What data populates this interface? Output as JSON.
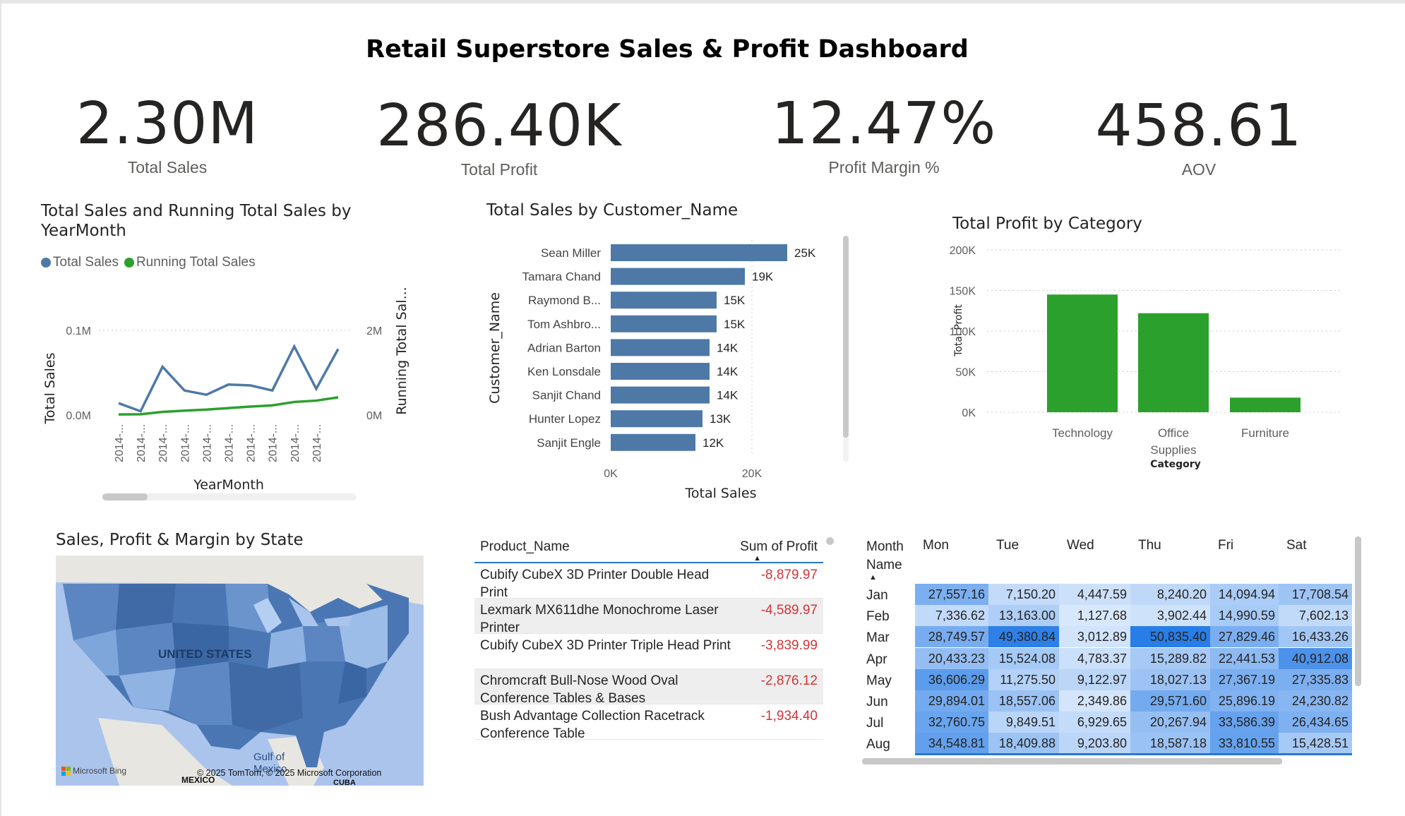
{
  "title": "Retail Superstore Sales & Profit Dashboard",
  "kpis": [
    {
      "value": "2.30M",
      "label": "Total Sales"
    },
    {
      "value": "286.40K",
      "label": "Total Profit"
    },
    {
      "value": "12.47%",
      "label": "Profit Margin %"
    },
    {
      "value": "458.61",
      "label": "AOV"
    }
  ],
  "colors": {
    "blue": "#4e79a7",
    "green": "#2ca02c",
    "neg": "#d13438",
    "accent": "#2a78c8"
  },
  "line_chart": {
    "title_line1": "Total Sales and Running Total Sales by",
    "title_line2": "YearMonth",
    "legend": [
      "Total Sales",
      "Running Total Sales"
    ],
    "y_left_title": "Total Sales",
    "y_right_title": "Running Total Sal...",
    "x_title": "YearMonth",
    "y_left_ticks": [
      "0.1M",
      "0.0M"
    ],
    "y_right_ticks": [
      "2M",
      "0M"
    ],
    "x_tick": "2014-..."
  },
  "bar_chart": {
    "title": "Total Sales by Customer_Name",
    "y_title": "Customer_Name",
    "x_title": "Total Sales",
    "x_ticks": [
      "0K",
      "20K"
    ]
  },
  "col_chart": {
    "title": "Total Profit by Category",
    "y_title": "Total Profit",
    "x_title": "Category",
    "y_ticks": [
      "200K",
      "150K",
      "100K",
      "50K",
      "0K"
    ]
  },
  "chart_data": [
    {
      "type": "line",
      "x": [
        "2014-...",
        "2014-...",
        "2014-...",
        "2014-...",
        "2014-...",
        "2014-...",
        "2014-...",
        "2014-...",
        "2014-...",
        "2014-..."
      ],
      "series": [
        {
          "name": "Total Sales",
          "axis": "left",
          "values": [
            14000,
            4500,
            57000,
            29000,
            24000,
            36000,
            35000,
            29000,
            81000,
            31000,
            78000
          ]
        },
        {
          "name": "Running Total Sales",
          "axis": "right",
          "values": [
            14000,
            18500,
            75500,
            104500,
            128500,
            164500,
            199500,
            228500,
            309500,
            340500,
            418500
          ]
        }
      ],
      "ylim_left": [
        0,
        100000
      ],
      "ylim_right": [
        0,
        2000000
      ],
      "grid": true
    },
    {
      "type": "bar",
      "orientation": "horizontal",
      "categories": [
        "Sean Miller",
        "Tamara Chand",
        "Raymond B...",
        "Tom Ashbro...",
        "Adrian Barton",
        "Ken Lonsdale",
        "Sanjit Chand",
        "Hunter Lopez",
        "Sanjit Engle"
      ],
      "values": [
        25000,
        19000,
        15000,
        15000,
        14000,
        14000,
        14000,
        13000,
        12000
      ],
      "labels": [
        "25K",
        "19K",
        "15K",
        "15K",
        "14K",
        "14K",
        "14K",
        "13K",
        "12K"
      ],
      "xlim": [
        0,
        25000
      ]
    },
    {
      "type": "bar",
      "categories": [
        "Technology",
        "Office Supplies",
        "Furniture"
      ],
      "values": [
        145000,
        122000,
        18000
      ],
      "ylim": [
        0,
        200000
      ],
      "grid": true
    }
  ],
  "map": {
    "title": "Sales, Profit & Margin by State",
    "country_label": "UNITED STATES",
    "gulf_label1": "Gulf of",
    "gulf_label2": "Mexico",
    "mexico_label": "MEXICO",
    "cuba_label": "CUBA",
    "brand": "Microsoft Bing",
    "copyright": "© 2025 TomTom, © 2025 Microsoft Corporation"
  },
  "product_table": {
    "col1": "Product_Name",
    "col2": "Sum of Profit",
    "rows": [
      {
        "name": "Cubify CubeX 3D Printer Double Head Print",
        "value": "-8,879.97"
      },
      {
        "name": "Lexmark MX611dhe Monochrome Laser Printer",
        "value": "-4,589.97"
      },
      {
        "name": "Cubify CubeX 3D Printer Triple Head Print",
        "value": "-3,839.99"
      },
      {
        "name": "Chromcraft Bull-Nose Wood Oval Conference Tables & Bases",
        "value": "-2,876.12"
      },
      {
        "name": "Bush Advantage Collection Racetrack Conference Table",
        "value": "-1,934.40"
      }
    ]
  },
  "matrix": {
    "corner_line1": "Month",
    "corner_line2": "Name",
    "days": [
      "Mon",
      "Tue",
      "Wed",
      "Thu",
      "Fri",
      "Sat"
    ],
    "rows": [
      {
        "month": "Jan",
        "cells": [
          "27,557.16",
          "7,150.20",
          "4,447.59",
          "8,240.20",
          "14,094.94",
          "17,708.54"
        ]
      },
      {
        "month": "Feb",
        "cells": [
          "7,336.62",
          "13,163.00",
          "1,127.68",
          "3,902.44",
          "14,990.59",
          "7,602.13"
        ]
      },
      {
        "month": "Mar",
        "cells": [
          "28,749.57",
          "49,380.84",
          "3,012.89",
          "50,835.40",
          "27,829.46",
          "16,433.26"
        ]
      },
      {
        "month": "Apr",
        "cells": [
          "20,433.23",
          "15,524.08",
          "4,783.37",
          "15,289.82",
          "22,441.53",
          "40,912.08"
        ]
      },
      {
        "month": "May",
        "cells": [
          "36,606.29",
          "11,275.50",
          "9,122.97",
          "18,027.13",
          "27,367.19",
          "27,335.83"
        ]
      },
      {
        "month": "Jun",
        "cells": [
          "29,894.01",
          "18,557.06",
          "2,349.86",
          "29,571.60",
          "25,896.19",
          "24,230.82"
        ]
      },
      {
        "month": "Jul",
        "cells": [
          "32,760.75",
          "9,849.51",
          "6,929.65",
          "20,267.94",
          "33,586.39",
          "26,434.65"
        ]
      },
      {
        "month": "Aug",
        "cells": [
          "34,548.81",
          "18,409.88",
          "9,203.80",
          "18,587.18",
          "33,810.55",
          "15,428.51"
        ]
      }
    ]
  }
}
